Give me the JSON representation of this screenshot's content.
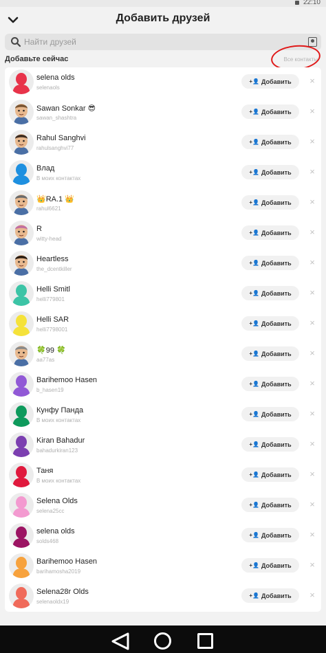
{
  "status_bar": {
    "time": "22:10"
  },
  "header": {
    "title": "Добавить друзей",
    "back_icon": "chevron-down-icon"
  },
  "search": {
    "placeholder": "Найти друзей",
    "icon": "search-icon",
    "right_icon": "contact-card-icon"
  },
  "section": {
    "title": "Добавьте сейчас",
    "all_contacts": "Все контакты"
  },
  "annotation": {
    "color": "#e01818"
  },
  "add_label": "Добавить",
  "colors": {
    "card": "#ffffff",
    "background": "#f2f2f2",
    "button_bg": "#f1f1f1"
  },
  "friends": [
    {
      "name": "selena olds",
      "username": "selenaols",
      "avatar": "silhouette",
      "color": "#e8334a"
    },
    {
      "name": "Sawan Sonkar 😎",
      "username": "sawan_shashtra",
      "avatar": "bitmoji",
      "color": "#7a5533"
    },
    {
      "name": "Rahul Sanghvi",
      "username": "rahulsanghvi77",
      "avatar": "bitmoji",
      "color": "#3d2b1f"
    },
    {
      "name": "Влад",
      "username": "В моих контактах",
      "avatar": "silhouette",
      "color": "#1e90e0"
    },
    {
      "name": "👑RA.1 👑",
      "username": "rahul6621",
      "avatar": "bitmoji",
      "color": "#6b6b6b"
    },
    {
      "name": "R",
      "username": "witty-head",
      "avatar": "bitmoji",
      "color": "#c26fa0"
    },
    {
      "name": "Heartless",
      "username": "the_dcentkiller",
      "avatar": "bitmoji",
      "color": "#2a1c12"
    },
    {
      "name": "Helli Smitl",
      "username": "helli779801",
      "avatar": "silhouette",
      "color": "#3cc4a6"
    },
    {
      "name": "Helli SAR",
      "username": "helli7798001",
      "avatar": "silhouette",
      "color": "#f5e23a"
    },
    {
      "name": "🍀99 🍀",
      "username": "aa77as",
      "avatar": "bitmoji",
      "color": "#8a8a8a"
    },
    {
      "name": "Barihemoo Hasen",
      "username": "b_hasen19",
      "avatar": "silhouette",
      "color": "#9159d6"
    },
    {
      "name": "Кунфу Панда",
      "username": "В моих контактах",
      "avatar": "silhouette",
      "color": "#0e9a5c"
    },
    {
      "name": "Kiran Bahadur",
      "username": "bahadurkiran123",
      "avatar": "silhouette",
      "color": "#7b3fb0"
    },
    {
      "name": "Таня",
      "username": "В моих контактах",
      "avatar": "silhouette",
      "color": "#e0193d"
    },
    {
      "name": "Selena Olds",
      "username": "selena25cc",
      "avatar": "silhouette",
      "color": "#f39ad0"
    },
    {
      "name": "selena olds",
      "username": "solds468",
      "avatar": "silhouette",
      "color": "#9c1463"
    },
    {
      "name": "Barihemoo Hasen",
      "username": "barihamosha2019",
      "avatar": "silhouette",
      "color": "#f7a23d"
    },
    {
      "name": "Selena28r Olds",
      "username": "selenaoldx19",
      "avatar": "silhouette",
      "color": "#f06a5a"
    }
  ]
}
